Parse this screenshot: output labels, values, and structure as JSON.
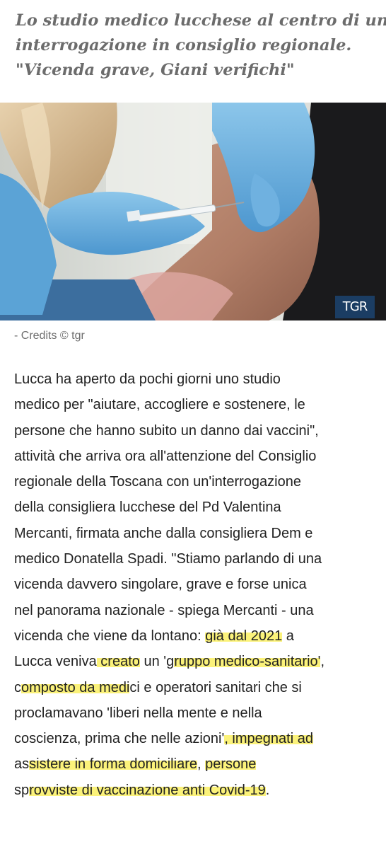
{
  "header": {
    "subtitle_lines": [
      "Lo studio medico lucchese al centro di una",
      "interrogazione in consiglio regionale.",
      "\"Vicenda grave, Giani verifichi\""
    ]
  },
  "image": {
    "logo_text": "TGR"
  },
  "credits": "- Credits © tgr",
  "article": {
    "lines": [
      "Lucca ha aperto da pochi giorni uno studio",
      "medico per \"aiutare, accogliere e sostenere, le",
      "persone che hanno subito un danno dai vaccini\",",
      "attività che arriva ora all'attenzione del Consiglio",
      "regionale della Toscana con un'interrogazione",
      "della consigliera lucchese del Pd Valentina",
      "Mercanti, firmata anche dalla consigliera Dem e",
      "medico Donatella Spadi. \"Stiamo parlando di una",
      "vicenda davvero singolare, grave e forse unica",
      "nel panorama nazionale - spiega Mercanti - una"
    ],
    "line11": {
      "a": "vicenda che viene da lontano: ",
      "b": "già dal 2021",
      "c": " a"
    },
    "line12": {
      "a": "Lucca veniva",
      "b": " creato",
      "c": " un 'g",
      "d": "ruppo medico-sanitario'",
      "e": ","
    },
    "line13": {
      "a": "c",
      "b": "omposto da medi",
      "c": "ci e operatori sanitari che si"
    },
    "line14": "proclamavano 'liberi nella mente e nella",
    "line15": {
      "a": "coscienza, prima che nelle azioni'",
      "b": ", impegnati ad"
    },
    "line16": {
      "a": "as",
      "b": "sistere in forma domiciliare",
      "c": ", ",
      "d": "persone"
    },
    "line17": {
      "a": "sp",
      "b": "rovviste di vaccinazione anti Covid-19",
      "c": "."
    }
  },
  "colors": {
    "highlight": "#fbf27a",
    "subtitle_text": "#6c6c6c",
    "body_text": "#222222",
    "logo_background": "#1b3d63"
  }
}
